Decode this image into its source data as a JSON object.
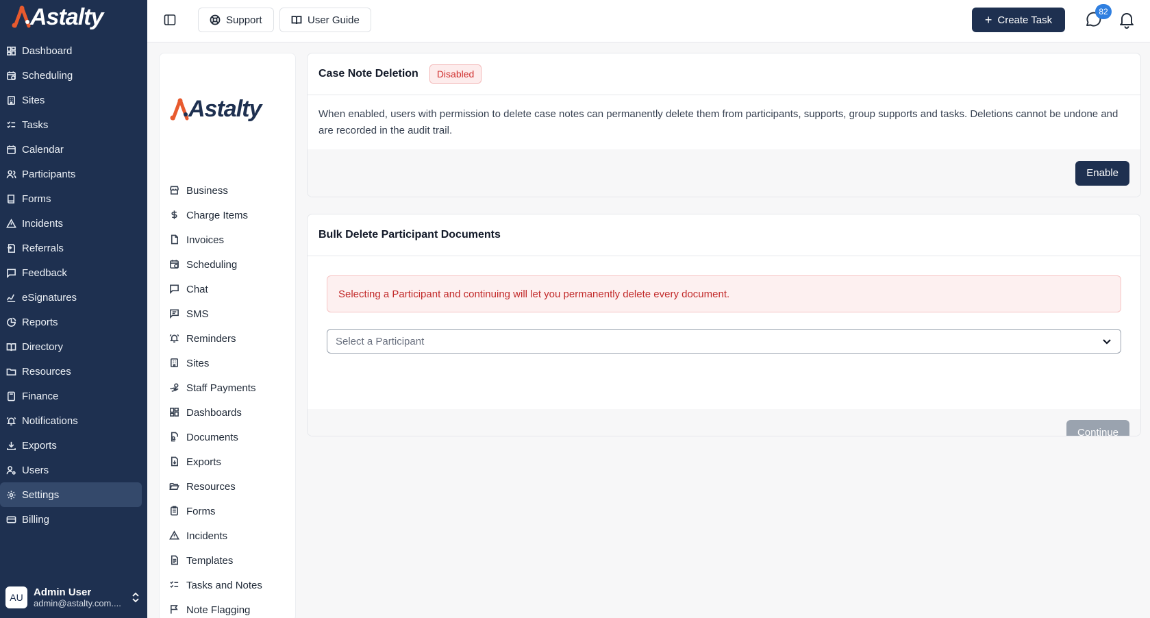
{
  "brand": {
    "name": "Astalty"
  },
  "sidebar": {
    "items": [
      {
        "label": "Dashboard",
        "icon": "dashboard-icon"
      },
      {
        "label": "Scheduling",
        "icon": "calendar-clock-icon"
      },
      {
        "label": "Sites",
        "icon": "building-icon"
      },
      {
        "label": "Tasks",
        "icon": "list-checks-icon"
      },
      {
        "label": "Calendar",
        "icon": "calendar-icon"
      },
      {
        "label": "Participants",
        "icon": "users-icon"
      },
      {
        "label": "Forms",
        "icon": "book-icon"
      },
      {
        "label": "Incidents",
        "icon": "warning-triangle-icon"
      },
      {
        "label": "Referrals",
        "icon": "referral-icon"
      },
      {
        "label": "Feedback",
        "icon": "message-square-icon"
      },
      {
        "label": "eSignatures",
        "icon": "signature-icon"
      },
      {
        "label": "Reports",
        "icon": "pie-chart-icon"
      },
      {
        "label": "Directory",
        "icon": "book-open-icon"
      },
      {
        "label": "Resources",
        "icon": "folder-icon"
      },
      {
        "label": "Finance",
        "icon": "calculator-icon"
      },
      {
        "label": "Notifications",
        "icon": "bell-ring-icon"
      },
      {
        "label": "Exports",
        "icon": "download-icon"
      },
      {
        "label": "Users",
        "icon": "user-cog-icon"
      },
      {
        "label": "Settings",
        "icon": "gear-icon",
        "active": true
      },
      {
        "label": "Billing",
        "icon": "credit-card-icon"
      }
    ],
    "user": {
      "initials": "AU",
      "name": "Admin User",
      "email": "admin@astalty.com...."
    }
  },
  "topbar": {
    "support_label": "Support",
    "guide_label": "User Guide",
    "create_label": "Create Task",
    "chat_badge": "82"
  },
  "settings_nav": {
    "items": [
      {
        "label": "Business",
        "icon": "store-icon"
      },
      {
        "label": "Charge Items",
        "icon": "dollar-icon"
      },
      {
        "label": "Invoices",
        "icon": "file-icon"
      },
      {
        "label": "Scheduling",
        "icon": "calendar-clock-icon"
      },
      {
        "label": "Chat",
        "icon": "message-square-icon"
      },
      {
        "label": "SMS",
        "icon": "message-text-icon"
      },
      {
        "label": "Reminders",
        "icon": "bell-ring-icon"
      },
      {
        "label": "Sites",
        "icon": "building-icon"
      },
      {
        "label": "Staff Payments",
        "icon": "hand-coins-icon"
      },
      {
        "label": "Dashboards",
        "icon": "dashboard-icon"
      },
      {
        "label": "Documents",
        "icon": "file-search-icon"
      },
      {
        "label": "Exports",
        "icon": "file-download-icon"
      },
      {
        "label": "Resources",
        "icon": "folder-open-icon"
      },
      {
        "label": "Forms",
        "icon": "clipboard-icon"
      },
      {
        "label": "Incidents",
        "icon": "warning-triangle-icon"
      },
      {
        "label": "Templates",
        "icon": "file-text-icon"
      },
      {
        "label": "Tasks and Notes",
        "icon": "list-checks-icon"
      },
      {
        "label": "Note Flagging",
        "icon": "flag-icon"
      }
    ]
  },
  "case_note": {
    "title": "Case Note Deletion",
    "status": "Disabled",
    "description": "When enabled, users with permission to delete case notes can permanently delete them from participants, supports, group supports and tasks. Deletions cannot be undone and are recorded in the audit trail.",
    "enable_label": "Enable"
  },
  "bulk_delete": {
    "title": "Bulk Delete Participant Documents",
    "warning": "Selecting a Participant and continuing will let you permanently delete every document.",
    "select_placeholder": "Select a Participant",
    "continue_label": "Continue"
  },
  "colors": {
    "sidebar": "#1e3050",
    "accent": "#e85a2e",
    "danger": "#d0302f",
    "badge": "#2f7fe0"
  }
}
